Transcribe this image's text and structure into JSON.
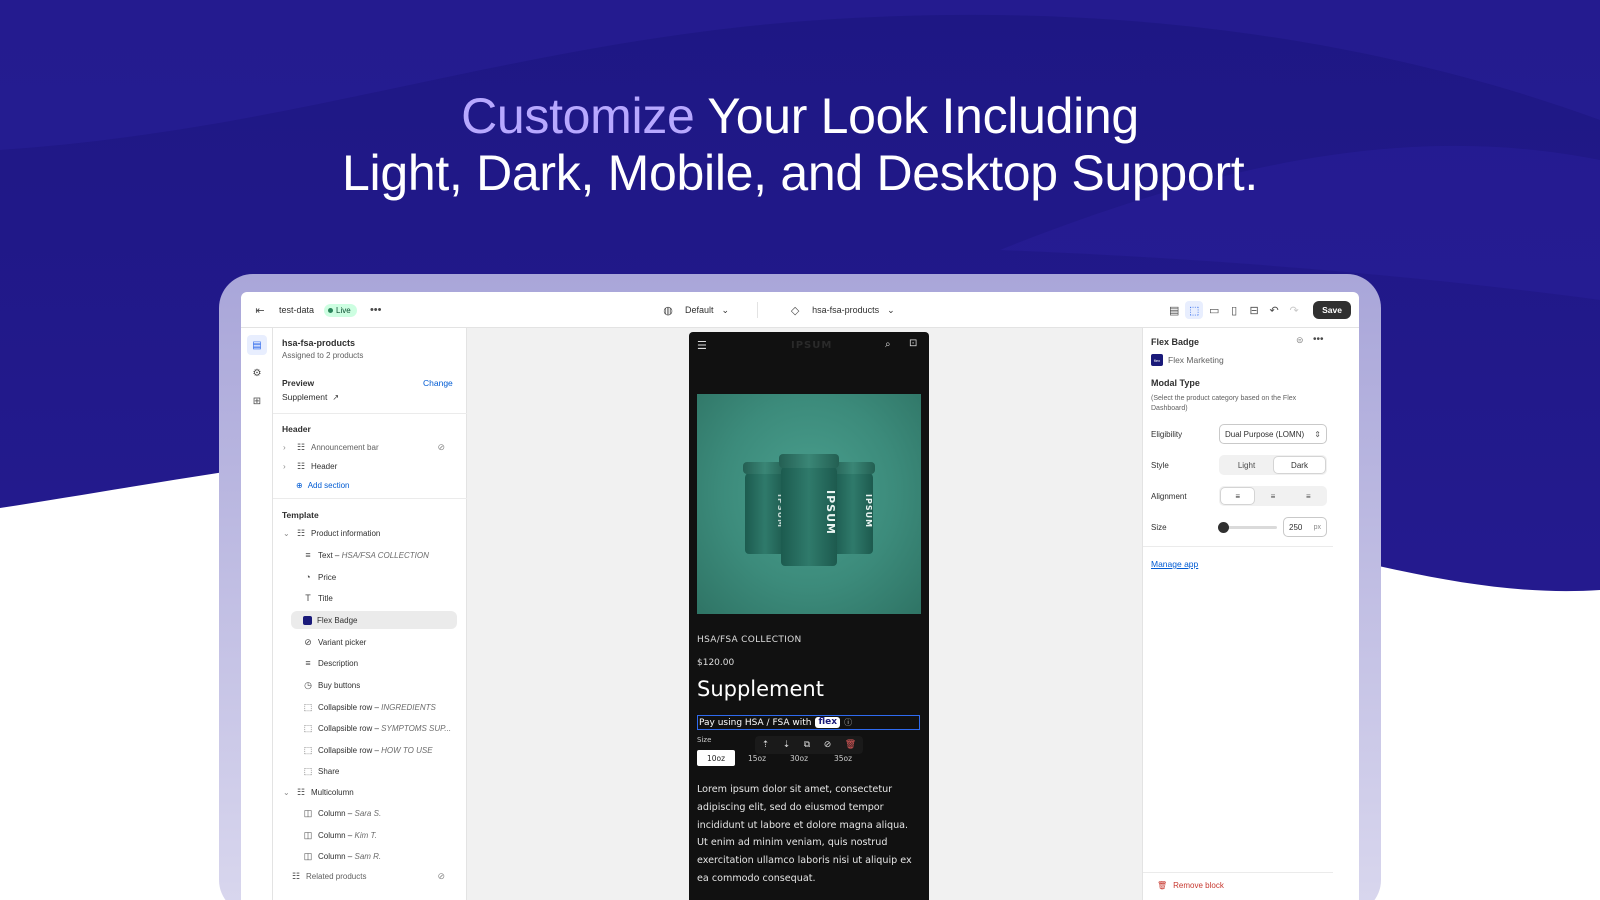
{
  "hero": {
    "accent": "Customize",
    "line1_rest": " Your Look Including",
    "line2": "Light, Dark, Mobile, and Desktop Support."
  },
  "topbar": {
    "store": "test-data",
    "status": "Live",
    "theme_select": "Default",
    "template_select": "hsa-fsa-products",
    "save": "Save"
  },
  "sidebar": {
    "title": "hsa-fsa-products",
    "subtitle": "Assigned to 2 products",
    "preview_label": "Preview",
    "preview_change": "Change",
    "preview_value": "Supplement",
    "header_section": "Header",
    "header_items": [
      "Announcement bar",
      "Header"
    ],
    "add_section": "Add section",
    "template_section": "Template",
    "product_information": "Product information",
    "blocks": [
      {
        "label": "Text",
        "detail": "HSA/FSA COLLECTION"
      },
      {
        "label": "Price",
        "detail": ""
      },
      {
        "label": "Title",
        "detail": ""
      },
      {
        "label": "Flex Badge",
        "detail": ""
      },
      {
        "label": "Variant picker",
        "detail": ""
      },
      {
        "label": "Description",
        "detail": ""
      },
      {
        "label": "Buy buttons",
        "detail": ""
      },
      {
        "label": "Collapsible row",
        "detail": "INGREDIENTS"
      },
      {
        "label": "Collapsible row",
        "detail": "SYMPTOMS SUP..."
      },
      {
        "label": "Collapsible row",
        "detail": "HOW TO USE"
      },
      {
        "label": "Share",
        "detail": ""
      }
    ],
    "multicolumn": "Multicolumn",
    "columns": [
      {
        "label": "Column",
        "detail": "Sara S."
      },
      {
        "label": "Column",
        "detail": "Kim T."
      },
      {
        "label": "Column",
        "detail": "Sam R."
      }
    ],
    "related_products": "Related products",
    "dash": " – "
  },
  "preview": {
    "brand": "IPSUM",
    "jar_brand": "IPSUM",
    "collection": "HSA/FSA COLLECTION",
    "price": "$120.00",
    "title": "Supplement",
    "hsa_text": "Pay using HSA / FSA with",
    "flex_logo": "flex",
    "size_label": "Size",
    "sizes": [
      "10oz",
      "15oz",
      "30oz",
      "35oz"
    ],
    "description": "Lorem ipsum dolor sit amet, consectetur adipiscing elit, sed do eiusmod tempor incididunt ut labore et dolore magna aliqua. Ut enim ad minim veniam, quis nostrud exercitation ullamco laboris nisi ut aliquip ex ea commodo consequat."
  },
  "panel": {
    "title": "Flex Badge",
    "app_name": "Flex Marketing",
    "app_logo": "flex",
    "modal_type": "Modal Type",
    "help": "(Select the product category based on the Flex Dashboard)",
    "eligibility_label": "Eligibility",
    "eligibility_value": "Dual Purpose (LOMN)",
    "style_label": "Style",
    "style_options": [
      "Light",
      "Dark"
    ],
    "style_selected": "Dark",
    "alignment_label": "Alignment",
    "size_label": "Size",
    "size_value": "250",
    "size_unit": "px",
    "manage_app": "Manage app",
    "remove_block": "Remove block"
  },
  "colors": {
    "background": "#231a8e",
    "accent_text": "#b7a8ff",
    "live_badge": "#cdfee1",
    "link": "#005bd3",
    "selection_outline": "#2f6bf0",
    "remove": "#c7382f"
  }
}
